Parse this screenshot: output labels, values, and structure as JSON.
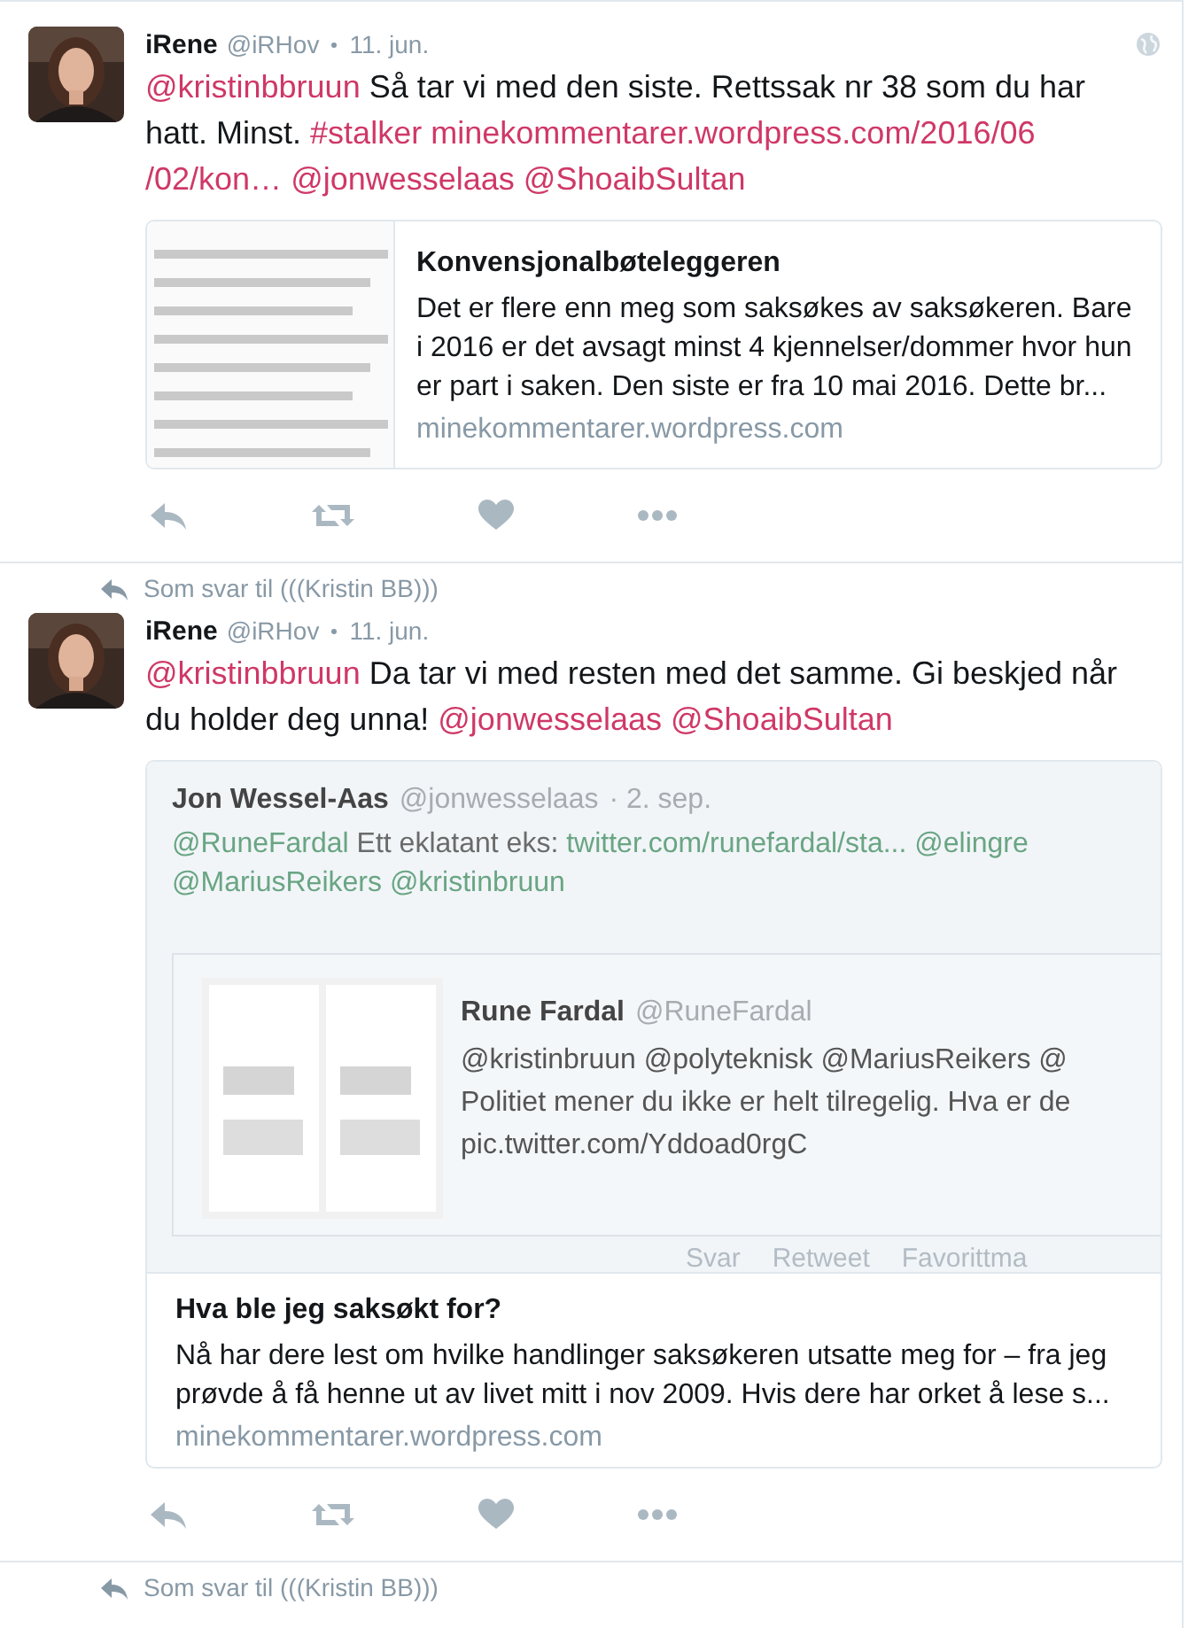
{
  "tweets": [
    {
      "name": "iRene",
      "handle": "@iRHov",
      "date": "11. jun.",
      "globe_icon": true,
      "lines": [
        [
          {
            "kind": "mention",
            "t": "@kristinbbruun"
          },
          {
            "kind": "text",
            "t": "Så tar vi med den siste. Rettssak nr 38 som du har"
          }
        ],
        [
          {
            "kind": "text",
            "t": "hatt. Minst."
          },
          {
            "kind": "hashtag",
            "t": "#stalker"
          },
          {
            "kind": "url",
            "t": "minekommentarer.wordpress.com/2016/06"
          }
        ],
        [
          {
            "kind": "url",
            "t": "/02/kon…"
          },
          {
            "kind": "mention",
            "t": "@jonwesselaas"
          },
          {
            "kind": "mention",
            "t": "@ShoaibSultan"
          }
        ]
      ],
      "card": {
        "kind": "side",
        "image": {
          "kind": "picture"
        },
        "title": "Konvensjonalbøteleggeren",
        "description": [
          "Det er flere enn meg som saksøkes av saksøkeren. Bare",
          "i 2016 er det avsagt minst 4 kjennelser/dommer hvor hun",
          "er part i saken. Den siste er fra 10 mai 2016. Dette br..."
        ],
        "domain": "minekommentarer.wordpress.com"
      }
    },
    {
      "reply_to": "Som svar til (((Kristin BB)))",
      "name": "iRene",
      "handle": "@iRHov",
      "date": "11. jun.",
      "globe_icon": false,
      "lines": [
        [
          {
            "kind": "mention",
            "t": "@kristinbbruun"
          },
          {
            "kind": "text",
            "t": "Da tar vi med resten med det samme. Gi beskjed når"
          }
        ],
        [
          {
            "kind": "text",
            "t": "du holder deg unna!"
          },
          {
            "kind": "mention",
            "t": "@jonwesselaas"
          },
          {
            "kind": "mention",
            "t": "@ShoaibSultan"
          }
        ]
      ],
      "card": {
        "kind": "top",
        "screenshot": {
          "name": "Jon Wessel-Aas",
          "handle": "@jonwesselaas",
          "date": "· 2. sep.",
          "lines": [
            [
              {
                "kind": "mention",
                "t": "@RuneFardal"
              },
              {
                "kind": "text",
                "t": "Ett eklatant eks:"
              },
              {
                "kind": "url",
                "t": "twitter.com/runefardal/sta..."
              },
              {
                "kind": "mention",
                "t": "@elingre"
              }
            ],
            [
              {
                "kind": "mention",
                "t": "@MariusReikers"
              },
              {
                "kind": "mention",
                "t": "@kristinbruun"
              }
            ]
          ],
          "quoted": {
            "image": {
              "kind": "picture"
            },
            "name": "Rune Fardal",
            "handle": "@RuneFardal",
            "lines": [
              "@kristinbruun @polyteknisk @MariusReikers @",
              "Politiet mener du ikke er helt tilregelig. Hva er de",
              "pic.twitter.com/Yddoad0rgC"
            ]
          },
          "actions": [
            "Svar",
            "Retweet",
            "Favorittma"
          ]
        },
        "title": "Hva ble jeg saksøkt for?",
        "description": [
          "Nå har dere lest om hvilke handlinger saksøkeren utsatte meg for – fra jeg",
          "prøvde å få henne ut av livet mitt i nov 2009. Hvis dere har orket å lese s..."
        ],
        "domain": "minekommentarer.wordpress.com"
      }
    }
  ],
  "trailing_reply": "Som svar til (((Kristin BB)))"
}
